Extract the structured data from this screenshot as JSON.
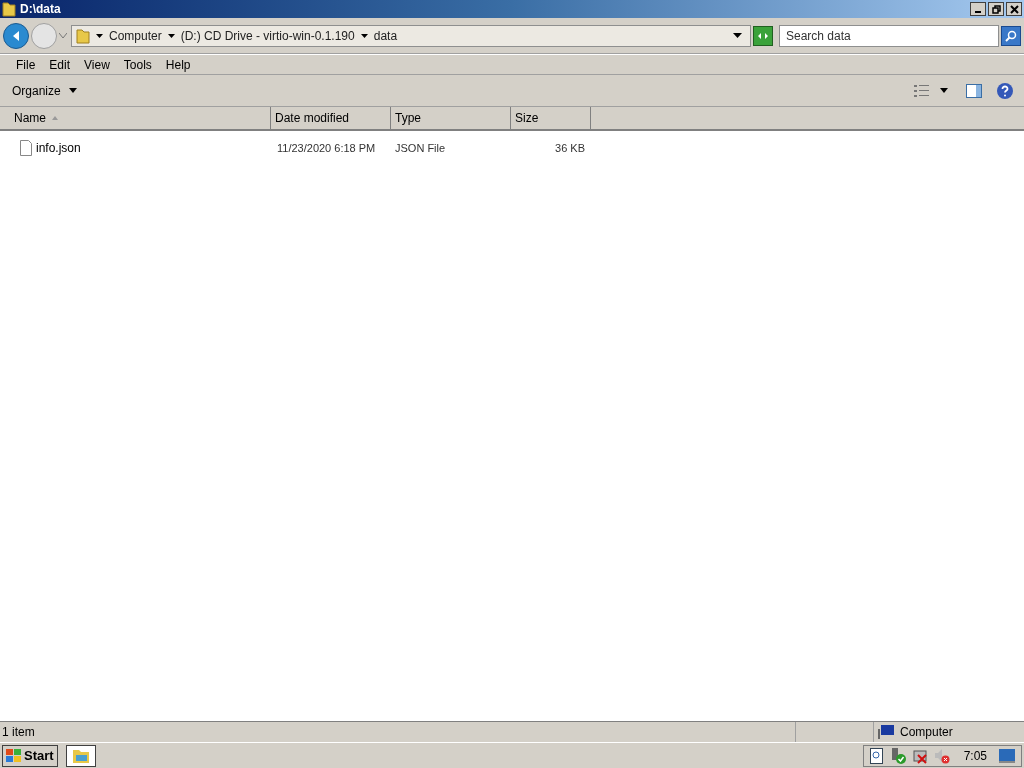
{
  "window": {
    "title": "D:\\data"
  },
  "breadcrumb": [
    "Computer",
    "(D:) CD Drive - virtio-win-0.1.190",
    "data"
  ],
  "search": {
    "placeholder": "Search data"
  },
  "menu": [
    "File",
    "Edit",
    "View",
    "Tools",
    "Help"
  ],
  "command_bar": {
    "organize": "Organize"
  },
  "columns": [
    {
      "label": "Name",
      "sorted": true
    },
    {
      "label": "Date modified",
      "sorted": false
    },
    {
      "label": "Type",
      "sorted": false
    },
    {
      "label": "Size",
      "sorted": false
    }
  ],
  "rows": [
    {
      "name": "info.json",
      "date_modified": "11/23/2020 6:18 PM",
      "type": "JSON File",
      "size": "36 KB",
      "selected": false
    }
  ],
  "status_bar": {
    "count": "1 item",
    "location": "Computer"
  },
  "taskbar": {
    "start": "Start",
    "clock": "7:05"
  }
}
